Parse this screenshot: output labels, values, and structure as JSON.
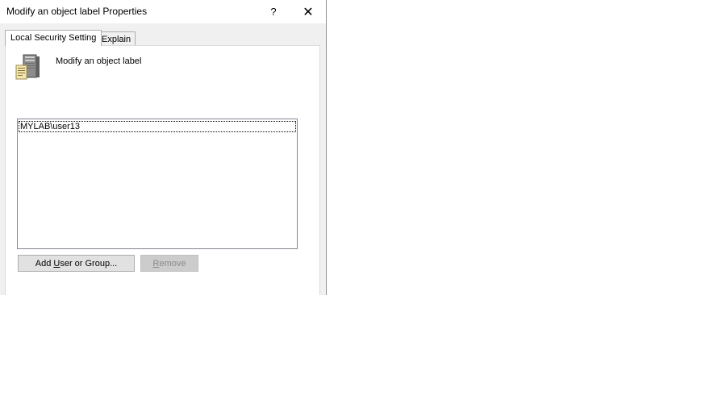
{
  "window": {
    "title": "Modify an object label Properties",
    "help_symbol": "?",
    "close_symbol": "✕"
  },
  "tabs": [
    {
      "label": "Local Security Setting",
      "selected": true
    },
    {
      "label": "Explain",
      "selected": false
    }
  ],
  "policy": {
    "name": "Modify an object label",
    "icon": "server-policy-icon"
  },
  "list": {
    "items": [
      "MYLAB\\user13"
    ]
  },
  "buttons": {
    "add": {
      "pre": "Add ",
      "mnemonic": "U",
      "post": "ser or Group..."
    },
    "remove": {
      "pre": "",
      "mnemonic": "R",
      "post": "emove",
      "disabled": true
    }
  }
}
